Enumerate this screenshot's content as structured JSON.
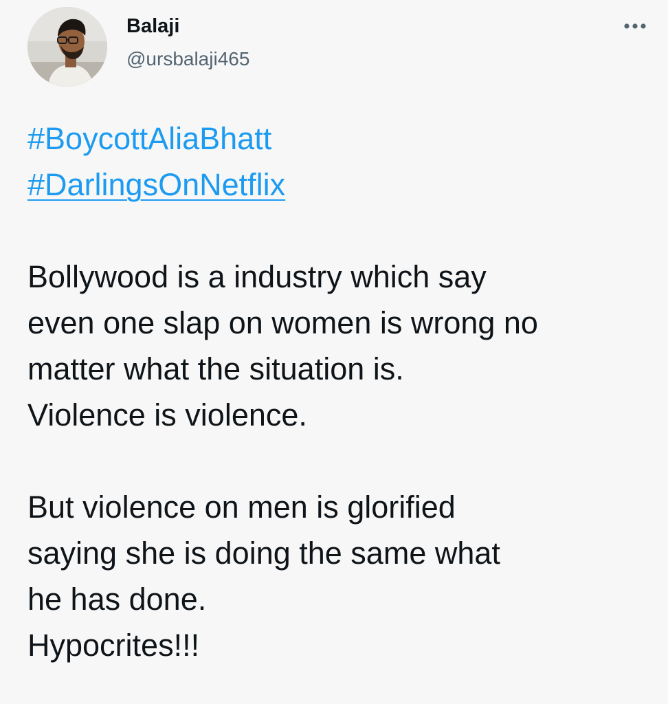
{
  "user": {
    "display_name": "Balaji",
    "handle": "@ursbalaji465"
  },
  "hashtags": [
    "#BoycottAliaBhatt",
    "#DarlingsOnNetflix"
  ],
  "paragraphs": [
    {
      "lines": [
        "Bollywood is a industry which say",
        "even one slap on women is wrong no",
        "matter what the situation is.",
        "Violence is violence."
      ]
    },
    {
      "lines": [
        "But violence on men is glorified",
        "saying she is doing the same what",
        "he has done.",
        "Hypocrites!!!"
      ]
    }
  ],
  "icons": {
    "avatar": "avatar-photo",
    "more": "more-options-icon"
  },
  "colors": {
    "background": "#f7f7f7",
    "hashtag": "#1d9bf0",
    "text": "#0f1419",
    "handle": "#536471"
  }
}
